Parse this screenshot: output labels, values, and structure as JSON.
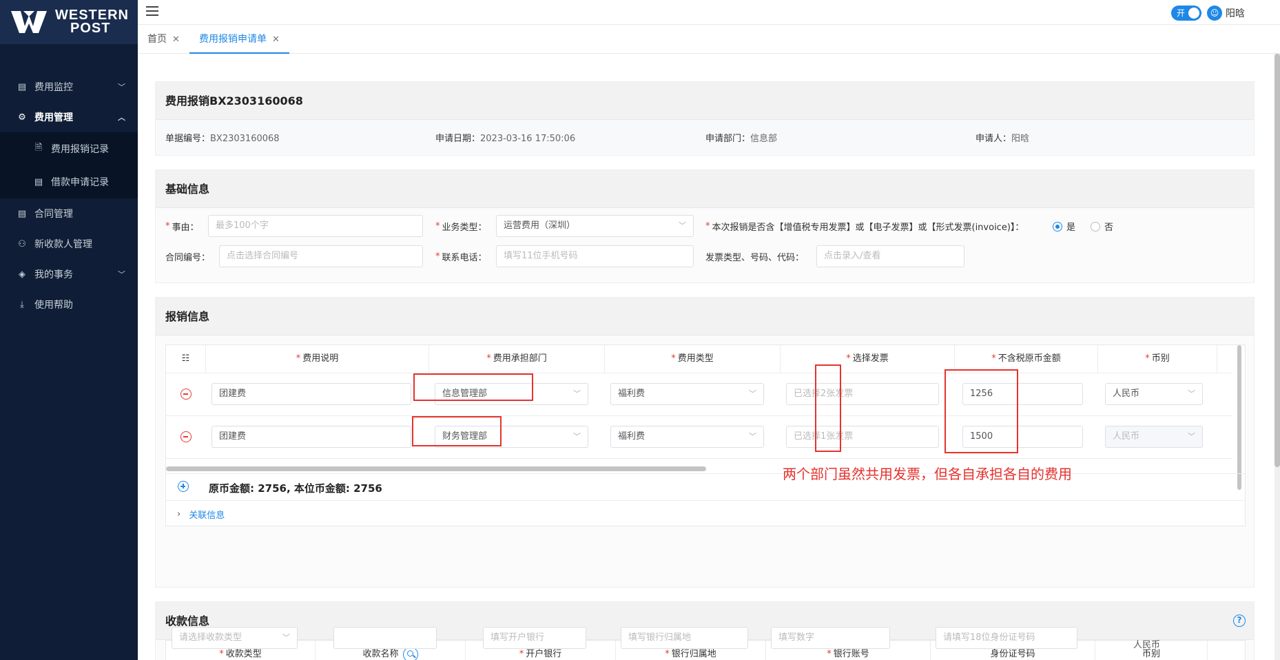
{
  "brand": {
    "line1": "WESTERN",
    "line2": "POST"
  },
  "sidebar": {
    "items": [
      {
        "label": "费用监控",
        "icon": "clipboard-icon"
      },
      {
        "label": "费用管理",
        "icon": "gear-icon"
      },
      {
        "label": "费用报销记录",
        "icon": "document-icon"
      },
      {
        "label": "借款申请记录",
        "icon": "list-icon"
      },
      {
        "label": "合同管理",
        "icon": "clipboard-icon"
      },
      {
        "label": "新收款人管理",
        "icon": "user-plus-icon"
      },
      {
        "label": "我的事务",
        "icon": "tag-icon"
      },
      {
        "label": "使用帮助",
        "icon": "download-icon"
      }
    ]
  },
  "header": {
    "toggle_label": "开",
    "user_name": "阳晗"
  },
  "tabs": [
    {
      "label": "首页"
    },
    {
      "label": "费用报销申请单"
    }
  ],
  "doc": {
    "title": "费用报销BX2303160068",
    "meta": [
      {
        "label": "单据编号：",
        "value": "BX2303160068"
      },
      {
        "label": "申请日期：",
        "value": "2023-03-16 17:50:06"
      },
      {
        "label": "申请部门：",
        "value": "信息部"
      },
      {
        "label": "申请人：",
        "value": "阳晗"
      }
    ]
  },
  "basic": {
    "title": "基础信息",
    "reason_label": "事由：",
    "reason_placeholder": "最多100个字",
    "biz_type_label": "业务类型：",
    "biz_type_value": "运营费用（深圳）",
    "invoice_question": "本次报销是否含【增值税专用发票】或【电子发票】或【形式发票(invoice)】：",
    "yes": "是",
    "no": "否",
    "contract_label": "合同编号：",
    "contract_placeholder": "点击选择合同编号",
    "phone_label": "联系电话：",
    "phone_placeholder": "填写11位手机号码",
    "invoice_type_label": "发票类型、号码、代码：",
    "invoice_type_placeholder": "点击录入/查看"
  },
  "reimburse": {
    "title": "报销信息",
    "columns": [
      "费用说明",
      "费用承担部门",
      "费用类型",
      "选择发票",
      "不含税原币金额",
      "币别"
    ],
    "rows": [
      {
        "desc": "团建费",
        "dept": "信息管理部",
        "type": "福利费",
        "invoice": "已选择2张发票",
        "amount": "1256",
        "currency": "人民币"
      },
      {
        "desc": "团建费",
        "dept": "财务管理部",
        "type": "福利费",
        "invoice": "已选择1张发票",
        "amount": "1500",
        "currency": "人民币"
      }
    ],
    "total": "原币金额: 2756, 本位币金额: 2756",
    "related": "关联信息"
  },
  "annotation": "两个部门虽然共用发票，但各自承担各自的费用",
  "payee": {
    "title": "收款信息",
    "help": "?",
    "columns": [
      "收款类型",
      "收款名称",
      "开户银行",
      "银行归属地",
      "银行账号",
      "身份证号码",
      "币别"
    ],
    "required": [
      true,
      false,
      true,
      true,
      true,
      false,
      false
    ],
    "placeholders": [
      "请选择收款类型",
      "",
      "填写开户银行",
      "填写银行归属地",
      "填写数字",
      "请填写18位身份证号码"
    ],
    "currency": "人民币"
  },
  "colors": {
    "accent": "#1e88e5",
    "danger": "#e53935",
    "sidebar": "#0f1e36"
  }
}
